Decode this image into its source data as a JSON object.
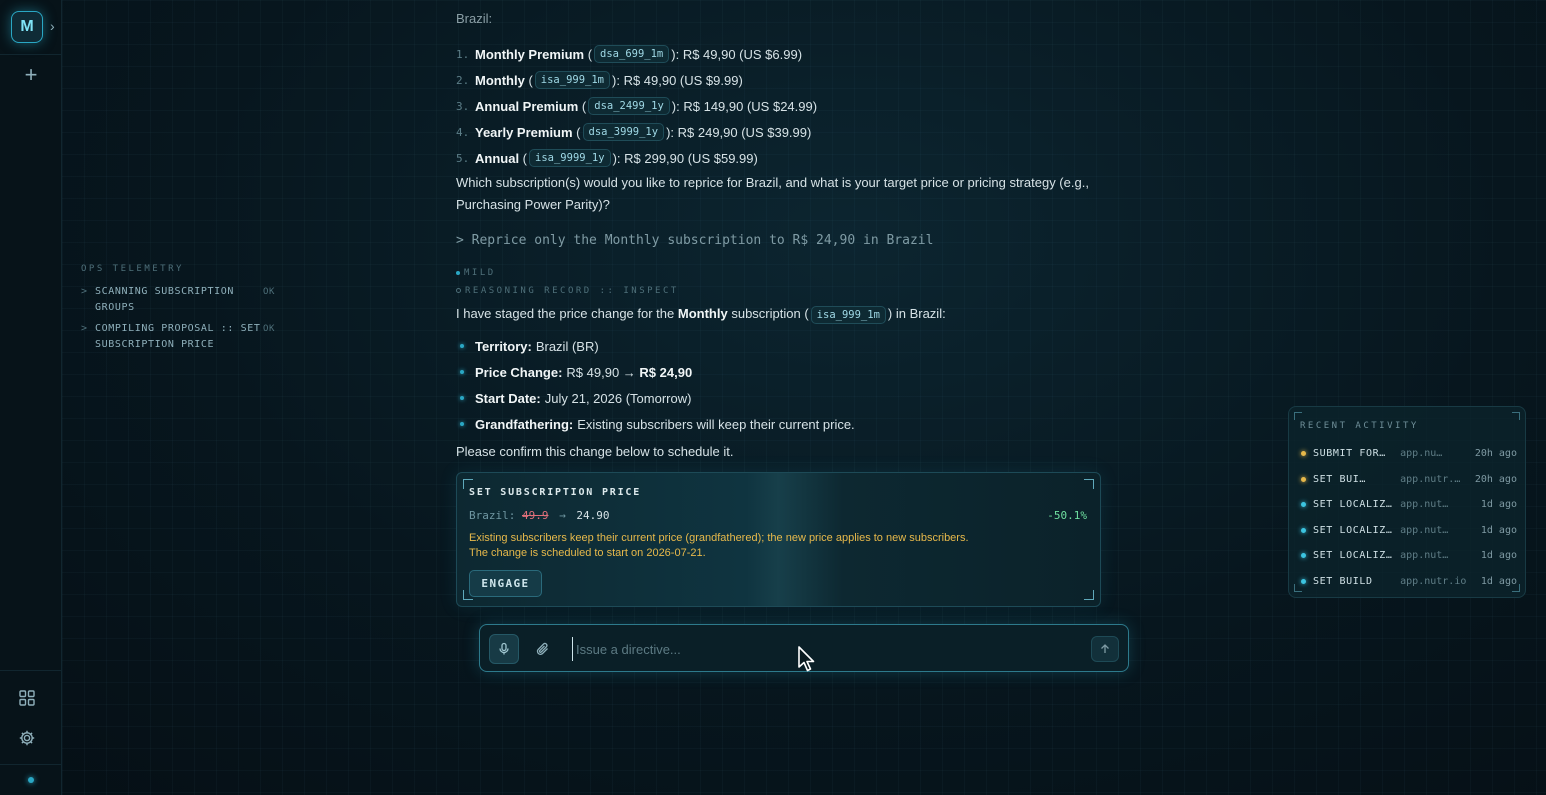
{
  "sidebar": {
    "logo_letter": "M",
    "items": [
      {
        "icon": "chevron-right-icon",
        "glyph": "›"
      },
      {
        "icon": "plus-icon",
        "glyph": "+"
      },
      {
        "icon": "grid-icon"
      },
      {
        "icon": "gear-icon"
      }
    ]
  },
  "telemetry": {
    "title": "OPS TELEMETRY",
    "items": [
      {
        "marker": ">",
        "text": "SCANNING SUBSCRIPTION GROUPS",
        "status": "OK"
      },
      {
        "marker": ">",
        "text": "COMPILING PROPOSAL :: SET SUBSCRIPTION PRICE",
        "status": "OK"
      }
    ]
  },
  "chat": {
    "region_label": "Brazil:",
    "plans": [
      {
        "num": "1.",
        "name": "Monthly Premium",
        "code": "dsa_699_1m",
        "price": "R$ 49,90 (US $6.99)"
      },
      {
        "num": "2.",
        "name": "Monthly",
        "code": "isa_999_1m",
        "price": "R$ 49,90 (US $9.99)"
      },
      {
        "num": "3.",
        "name": "Annual Premium",
        "code": "dsa_2499_1y",
        "price": "R$ 149,90 (US $24.99)"
      },
      {
        "num": "4.",
        "name": "Yearly Premium",
        "code": "dsa_3999_1y",
        "price": "R$ 249,90 (US $39.99)"
      },
      {
        "num": "5.",
        "name": "Annual",
        "code": "isa_9999_1y",
        "price": "R$ 299,90 (US $59.99)"
      }
    ],
    "question": "Which subscription(s) would you like to reprice for Brazil, and what is your target price or pricing strategy (e.g., Purchasing Power Parity)?",
    "user_command": "> Reprice only the Monthly subscription to R$ 24,90 in Brazil",
    "tag_mild": "MILD",
    "tag_reasoning": "REASONING RECORD :: INSPECT",
    "staged": {
      "prefix": "I have staged the price change for the",
      "plan": "Monthly",
      "middle": "subscription",
      "code": "isa_999_1m",
      "suffix": "in Brazil:"
    },
    "details": [
      {
        "label": "Territory:",
        "value": "Brazil (BR)"
      },
      {
        "label": "Price Change:",
        "value": "R$ 49,90 →",
        "strong": "R$ 24,90"
      },
      {
        "label": "Start Date:",
        "value": "July 21, 2026 (Tomorrow)"
      },
      {
        "label": "Grandfathering:",
        "value": "Existing subscribers will keep their current price."
      }
    ],
    "confirm": "Please confirm this change below to schedule it."
  },
  "proposal": {
    "title": "SET SUBSCRIPTION PRICE",
    "territory": "Brazil:",
    "old_price": "49.9",
    "arrow": "→",
    "new_price": "24.90",
    "change_pct": "-50.1%",
    "note_line1": "Existing subscribers keep their current price (grandfathered); the new price applies to new subscribers.",
    "note_line2": "The change is scheduled to start on 2026-07-21.",
    "action_label": "ENGAGE"
  },
  "input": {
    "placeholder": "Issue a directive...",
    "value": ""
  },
  "recent_activity": {
    "title": "RECENT ACTIVITY",
    "items": [
      {
        "name": "SUBMIT FOR…",
        "app": "app.nu…",
        "time": "20h ago",
        "color": "#e6b84a"
      },
      {
        "name": "SET BUI…",
        "app": "app.nutr.…",
        "time": "20h ago",
        "color": "#e6b84a"
      },
      {
        "name": "SET LOCALIZ…",
        "app": "app.nut…",
        "time": "1d ago",
        "color": "#3cc4e0"
      },
      {
        "name": "SET LOCALIZ…",
        "app": "app.nut…",
        "time": "1d ago",
        "color": "#3cc4e0"
      },
      {
        "name": "SET LOCALIZ…",
        "app": "app.nut…",
        "time": "1d ago",
        "color": "#3cc4e0"
      },
      {
        "name": "SET BUILD",
        "app": "app.nutr.io",
        "time": "1d ago",
        "color": "#3cc4e0"
      }
    ]
  },
  "colors": {
    "accent": "#2aa7c4",
    "warning": "#e7b94b",
    "success": "#6fe0a0",
    "danger": "#e0707a"
  }
}
